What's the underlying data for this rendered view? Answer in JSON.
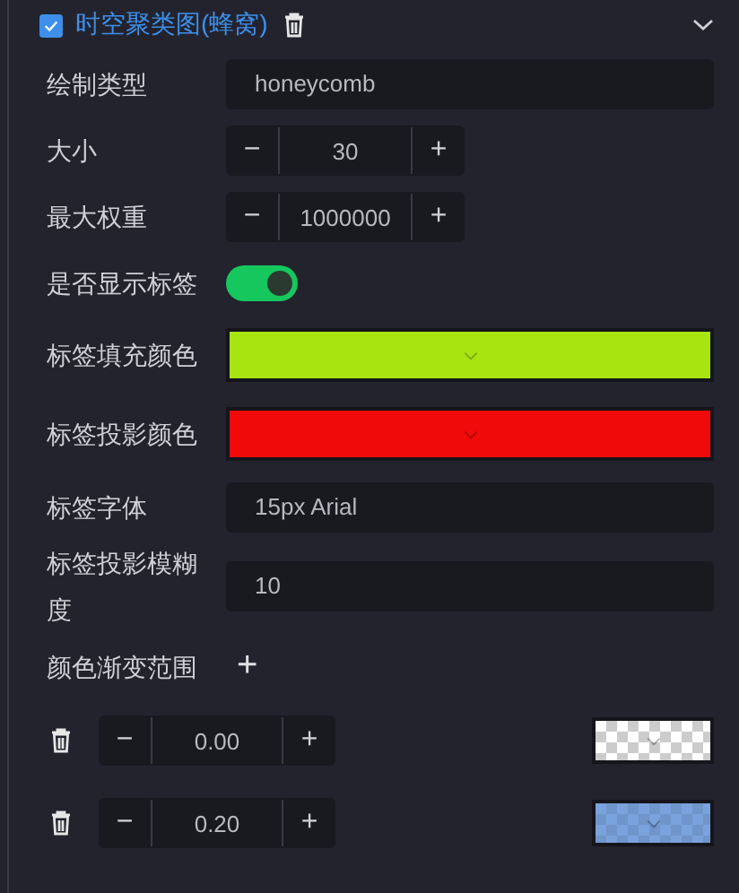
{
  "header": {
    "title": "时空聚类图(蜂窝)",
    "checked": true,
    "expanded": true
  },
  "rows": [
    {
      "kind": "text",
      "label": "绘制类型",
      "value": "honeycomb"
    },
    {
      "kind": "stepper",
      "label": "大小",
      "value": "30",
      "minus": "−",
      "plus": "+"
    },
    {
      "kind": "stepper",
      "label": "最大权重",
      "value": "1000000",
      "minus": "−",
      "plus": "+"
    },
    {
      "kind": "switch",
      "label": "是否显示标签",
      "on": true
    },
    {
      "kind": "color",
      "label": "标签填充颜色",
      "color": "#a8e410"
    },
    {
      "kind": "color",
      "label": "标签投影颜色",
      "color": "#f00a0a"
    },
    {
      "kind": "text",
      "label": "标签字体",
      "value": "15px Arial"
    },
    {
      "kind": "text",
      "label": "标签投影模糊度",
      "value": "10"
    }
  ],
  "gradient": {
    "label": "颜色渐变范围",
    "add": "+",
    "stops": [
      {
        "value": "0.00",
        "minus": "−",
        "plus": "+",
        "transparent": true
      },
      {
        "value": "0.20",
        "minus": "−",
        "plus": "+",
        "transparent": false,
        "color": "#7aa2dc"
      }
    ]
  }
}
